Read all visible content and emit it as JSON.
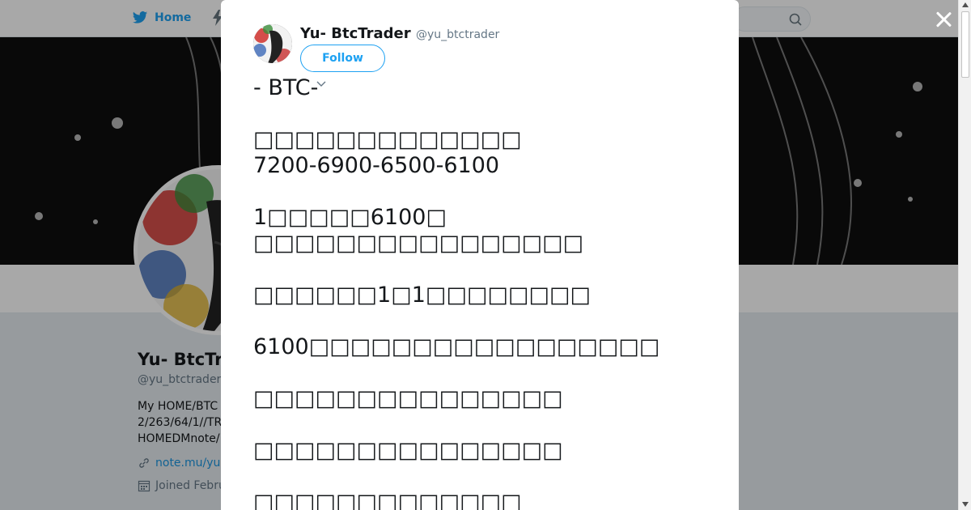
{
  "nav": {
    "home_label": "Home",
    "icons": [
      "twitter-bird-icon",
      "lightning-icon",
      "search-icon"
    ]
  },
  "profile": {
    "name": "Yu- BtcTr",
    "handle": "@yu_btctrader",
    "bio_lines": [
      "My HOME/BTC",
      "2/263/64/1//TR",
      "HOMEDMnote/"
    ],
    "link": "note.mu/yu",
    "joined": "Joined Febru"
  },
  "tweet": {
    "author_name": "Yu- BtcTrader",
    "author_handle": "@yu_btctrader",
    "follow_label": "Follow",
    "lines": [
      {
        "text": "- BTC-",
        "gap": false
      },
      {
        "text": "□□□□□□□□□□□□□",
        "gap": true
      },
      {
        "text": "7200-6900-6500-6100",
        "gap": false
      },
      {
        "text": "1□□□□□6100□",
        "gap": true
      },
      {
        "text": "□□□□□□□□□□□□□□□□",
        "gap": false
      },
      {
        "text": "□□□□□□1□1□□□□□□□□",
        "gap": true
      },
      {
        "text": "6100□□□□□□□□□□□□□□□□□",
        "gap": true
      },
      {
        "text": "□□□□□□□□□□□□□□□",
        "gap": true
      },
      {
        "text": "□□□□□□□□□□□□□□□",
        "gap": true
      },
      {
        "text": "□□□□□□□□□□□□□",
        "gap": true
      }
    ]
  },
  "colors": {
    "accent": "#1da1f2",
    "link": "#1b95e0",
    "text": "#14171a",
    "muted": "#657786"
  }
}
